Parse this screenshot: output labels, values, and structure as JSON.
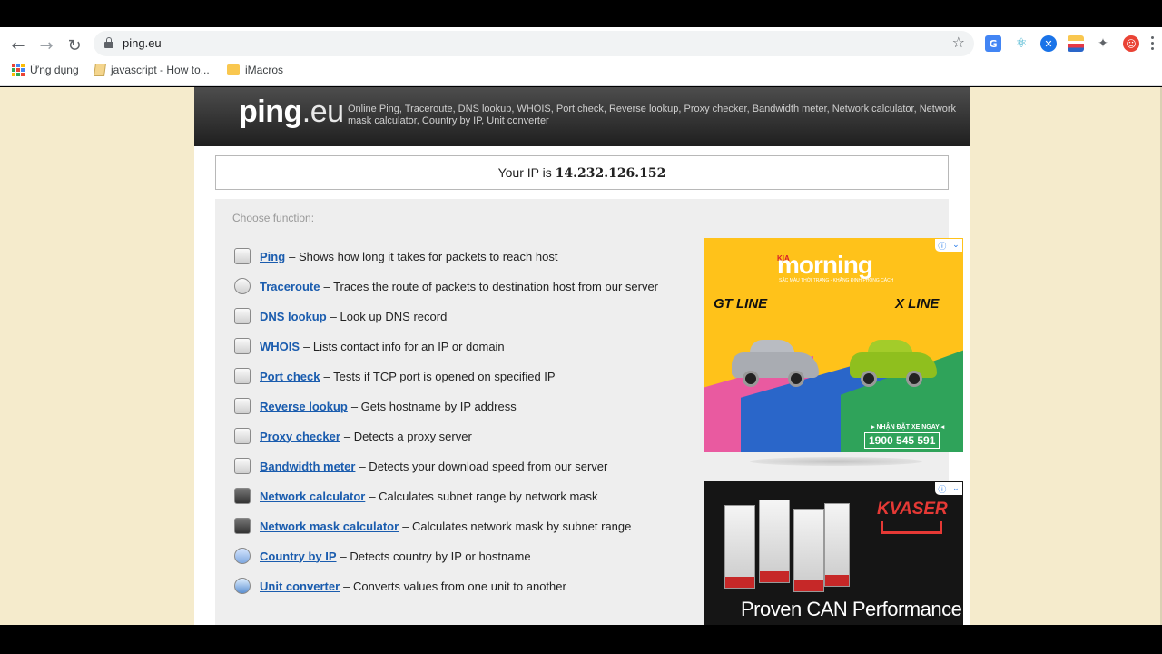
{
  "browser": {
    "url": "ping.eu",
    "bookmarks": [
      {
        "label": "Ứng dụng"
      },
      {
        "label": "javascript - How to..."
      },
      {
        "label": "iMacros"
      }
    ],
    "extension_icons": [
      "google-translate-icon",
      "react-devtools-icon",
      "vpn-extension-icon",
      "flag-extension-icon",
      "puzzle-extensions-icon",
      "profile-avatar-icon"
    ]
  },
  "site": {
    "logo_main": "ping",
    "logo_suffix": ".eu",
    "tagline": "Online Ping, Traceroute, DNS lookup, WHOIS, Port check, Reverse lookup, Proxy checker, Bandwidth meter, Network calculator, Network mask calculator, Country by IP, Unit converter",
    "ip_prefix": "Your IP is",
    "ip_value": "14.232.126.152",
    "choose_label": "Choose function:",
    "functions": [
      {
        "name": "Ping",
        "desc": "– Shows how long it takes for packets to reach host"
      },
      {
        "name": "Traceroute",
        "desc": "– Traces the route of packets to destination host from our server"
      },
      {
        "name": "DNS lookup",
        "desc": "– Look up DNS record"
      },
      {
        "name": "WHOIS",
        "desc": "– Lists contact info for an IP or domain"
      },
      {
        "name": "Port check",
        "desc": "– Tests if TCP port is opened on specified IP"
      },
      {
        "name": "Reverse lookup",
        "desc": "– Gets hostname by IP address"
      },
      {
        "name": "Proxy checker",
        "desc": "– Detects a proxy server"
      },
      {
        "name": "Bandwidth meter",
        "desc": "– Detects your download speed from our server"
      },
      {
        "name": "Network calculator",
        "desc": "– Calculates subnet range by network mask"
      },
      {
        "name": "Network mask calculator",
        "desc": "– Calculates network mask by subnet range"
      },
      {
        "name": "Country by IP",
        "desc": "– Detects country by IP or hostname"
      },
      {
        "name": "Unit converter",
        "desc": "– Converts values from one unit to another"
      }
    ]
  },
  "ads": {
    "ad1": {
      "brand_small": "KIA",
      "brand": "morning",
      "subtitle": "SẮC MÀU THỜI TRANG - KHẲNG ĐỊNH PHONG CÁCH",
      "trim_left": "GT LINE",
      "trim_right": "X LINE",
      "cta": "▸ NHẬN ĐẶT XE NGAY ◂",
      "phone": "1900 545 591"
    },
    "ad2": {
      "brand": "KVASER",
      "headline": "Proven CAN Performance"
    }
  },
  "colors": {
    "page_bg": "#f5ebcc",
    "link": "#1a5cae",
    "header_dark": "#2b2b2b"
  }
}
